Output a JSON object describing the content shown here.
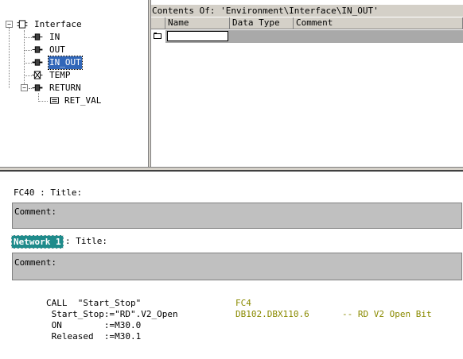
{
  "tree": {
    "root": "Interface",
    "items": [
      {
        "label": "IN"
      },
      {
        "label": "OUT"
      },
      {
        "label": "IN_OUT",
        "selected": true
      },
      {
        "label": "TEMP"
      },
      {
        "label": "RETURN",
        "children": [
          {
            "label": "RET_VAL"
          }
        ]
      }
    ]
  },
  "contents": {
    "title": "Contents Of: 'Environment\\Interface\\IN_OUT'",
    "columns": [
      "Name",
      "Data Type",
      "Comment"
    ]
  },
  "editor": {
    "block_title": "FC40 : Title:",
    "block_comment_label": "Comment:",
    "network_label": "Network 1",
    "network_title": ": Title:",
    "network_comment_label": "Comment:",
    "code": {
      "call_line": "CALL  \"Start_Stop\"",
      "call_ref": "FC4",
      "params": [
        {
          "text": " Start_Stop:=\"RD\".V2_Open",
          "addr": "DB102.DBX110.6",
          "comment": "-- RD V2 Open Bit"
        },
        {
          "text": " ON        :=M30.0",
          "addr": "",
          "comment": ""
        },
        {
          "text": " Released  :=M30.1",
          "addr": "",
          "comment": ""
        }
      ]
    }
  },
  "colors": {
    "selection": "#3167b9",
    "network_badge": "#1f8b8b",
    "address": "#8a8a00"
  }
}
